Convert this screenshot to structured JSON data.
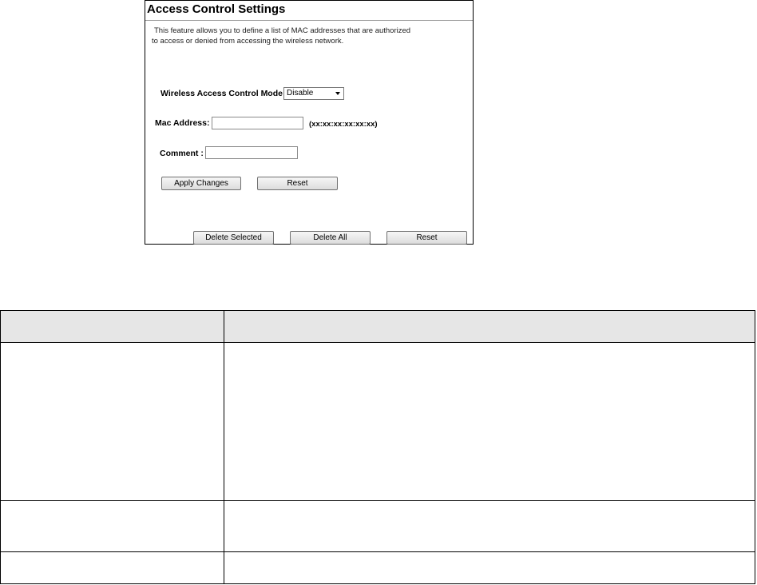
{
  "panel": {
    "title": "Access Control Settings",
    "description_line1": "This feature allows you to define a list of MAC addresses that are authorized",
    "description_line2": "to access or denied from accessing the wireless network.",
    "mode_label": "Wireless Access Control Mode:",
    "mode_value": "Disable",
    "mac_label": "Mac Address:",
    "mac_value": "",
    "mac_hint": "(xx:xx:xx:xx:xx:xx)",
    "comment_label": "Comment :",
    "comment_value": "",
    "apply_label": "Apply Changes",
    "reset_label": "Reset",
    "delete_selected_label": "Delete Selected",
    "delete_all_label": "Delete All",
    "reset2_label": "Reset"
  },
  "table": {
    "rows": [
      {
        "cells": [
          "",
          ""
        ]
      },
      {
        "cells": [
          "",
          ""
        ]
      },
      {
        "cells": [
          "",
          ""
        ]
      }
    ]
  }
}
